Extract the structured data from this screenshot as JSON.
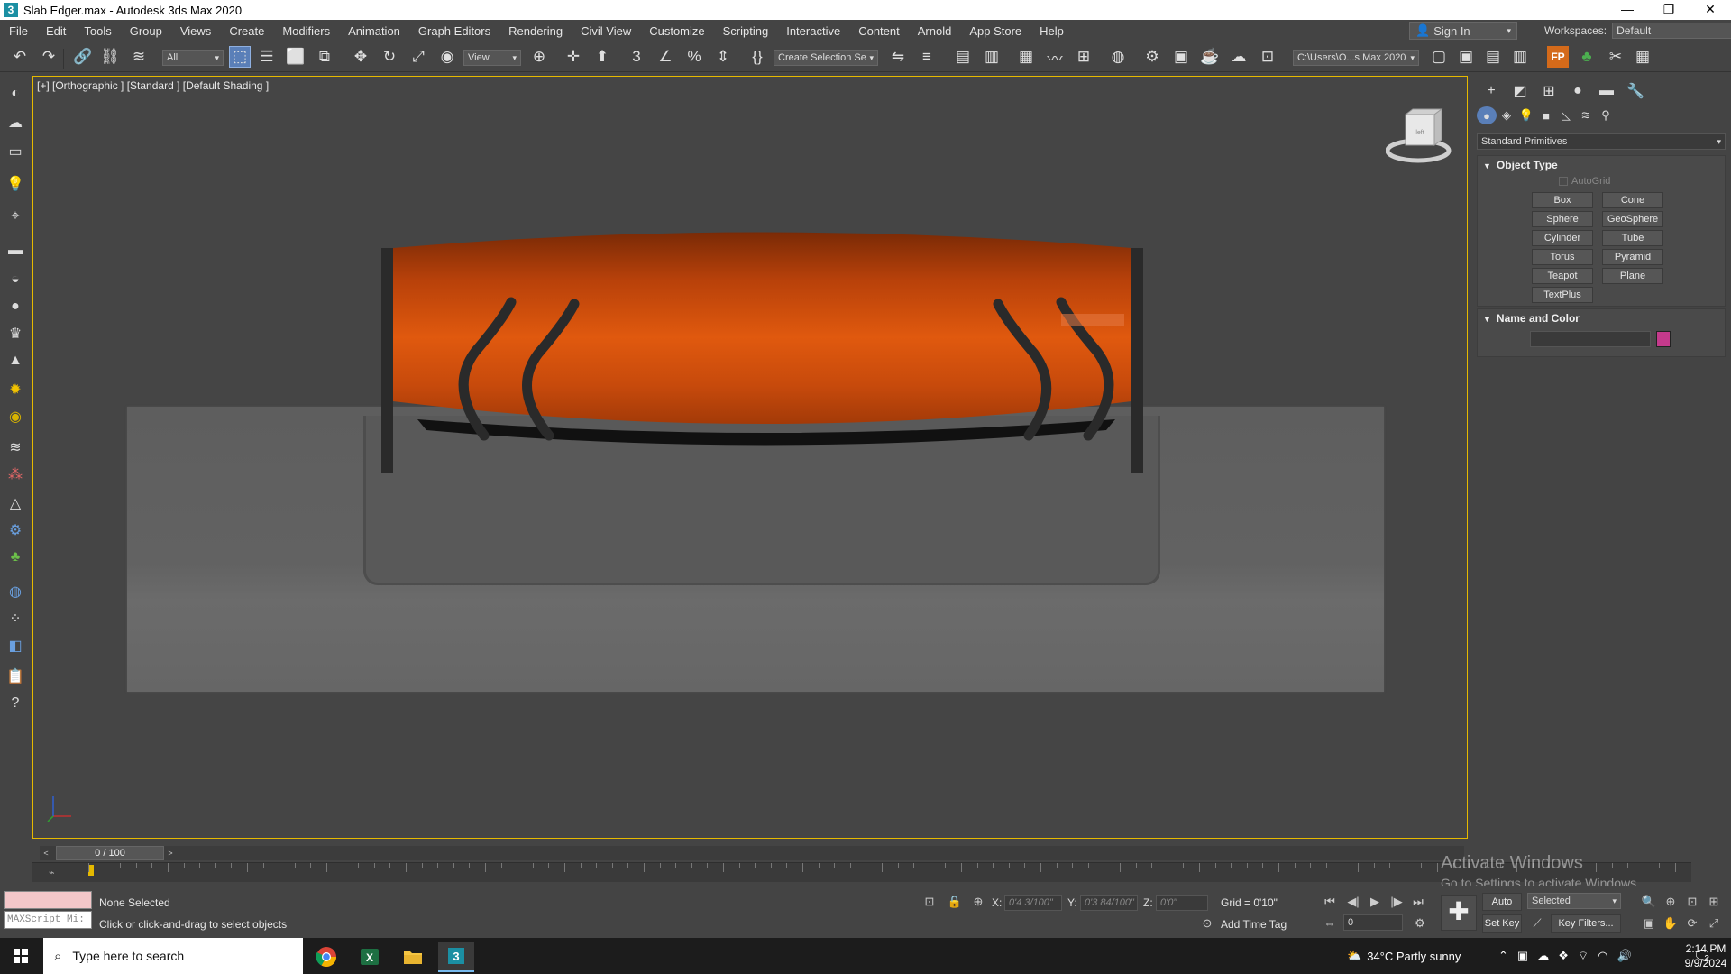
{
  "window": {
    "title": "Slab Edger.max - Autodesk 3ds Max 2020",
    "app_icon_text": "3",
    "controls": [
      "—",
      "❐",
      "✕"
    ]
  },
  "menu": [
    "File",
    "Edit",
    "Tools",
    "Group",
    "Views",
    "Create",
    "Modifiers",
    "Animation",
    "Graph Editors",
    "Rendering",
    "Civil View",
    "Customize",
    "Scripting",
    "Interactive",
    "Content",
    "Arnold",
    "App Store",
    "Help"
  ],
  "account": {
    "sign_in": "Sign In",
    "workspaces_label": "Workspaces:",
    "workspace_value": "Default"
  },
  "toolbar": {
    "selection_filter": "All",
    "ref_coord": "View",
    "named_selection": "Create Selection Se",
    "project_path": "C:\\Users\\O...s Max 2020"
  },
  "viewport": {
    "label": "[+] [Orthographic ] [Standard ] [Default Shading ]",
    "viewcube_face": "left"
  },
  "command_panel": {
    "category_dropdown": "Standard Primitives",
    "object_type": {
      "title": "Object Type",
      "autogrid": "AutoGrid",
      "buttons": [
        "Box",
        "Cone",
        "Sphere",
        "GeoSphere",
        "Cylinder",
        "Tube",
        "Torus",
        "Pyramid",
        "Teapot",
        "Plane",
        "TextPlus"
      ]
    },
    "name_and_color": {
      "title": "Name and Color",
      "name_value": "",
      "color": "#c43a8c"
    }
  },
  "timeline": {
    "frame_display": "0 / 100",
    "start": 0,
    "end": 100
  },
  "status": {
    "maxscript_placeholder": "MAXScript Mi:",
    "selection": "None Selected",
    "prompt": "Click or click-and-drag to select objects",
    "x_label": "X:",
    "x_value": "0'4 3/100\"",
    "y_label": "Y:",
    "y_value": "0'3 84/100\"",
    "z_label": "Z:",
    "z_value": "0'0\"",
    "grid": "Grid = 0'10\"",
    "add_time_tag": "Add Time Tag",
    "auto_key": "Auto Key",
    "set_key": "Set Key",
    "key_mode": "Selected",
    "key_filters": "Key Filters...",
    "current_frame": "0"
  },
  "activation": {
    "line1": "Activate Windows",
    "line2": "Go to Settings to activate Windows."
  },
  "taskbar": {
    "search_placeholder": "Type here to search",
    "weather": "34°C  Partly sunny",
    "time": "2:14 PM",
    "date": "9/9/2024",
    "notifications": "2"
  }
}
